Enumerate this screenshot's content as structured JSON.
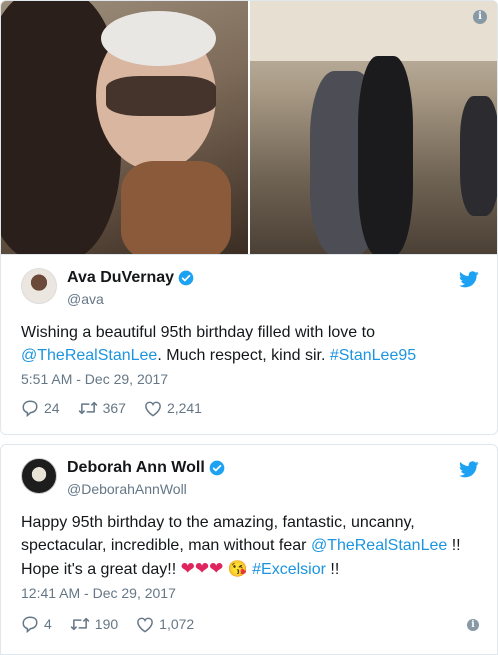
{
  "tweets": [
    {
      "display_name": "Ava DuVernay",
      "handle": "@ava",
      "text_before": "Wishing a beautiful 95th birthday filled with love to ",
      "mention": "@TheRealStanLee",
      "text_middle": ". Much respect, kind sir. ",
      "hashtag": "#StanLee95",
      "timestamp": "5:51 AM - Dec 29, 2017",
      "replies": "24",
      "retweets": "367",
      "likes": "2,241"
    },
    {
      "display_name": "Deborah Ann Woll",
      "handle": "@DeborahAnnWoll",
      "text_before": "Happy 95th birthday to the amazing, fantastic, uncanny, spectacular, incredible, man without fear ",
      "mention": "@TheRealStanLee",
      "text_middle": " !! Hope it's a great day!! ",
      "emoji": "❤❤❤",
      "kiss_emoji": "😘",
      "hashtag": "#Excelsior",
      "text_after": " !!",
      "timestamp": "12:41 AM - Dec 29, 2017",
      "replies": "4",
      "retweets": "190",
      "likes": "1,072"
    }
  ],
  "colors": {
    "link": "#1b95e0",
    "verified": "#1da1f2",
    "twitter_bird": "#1da1f2",
    "meta": "#657786",
    "heart": "#e0245e"
  }
}
